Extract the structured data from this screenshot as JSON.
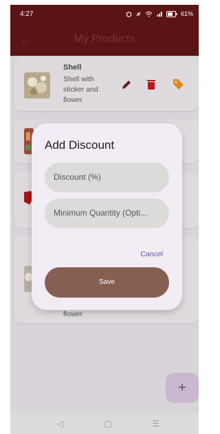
{
  "status_bar": {
    "time": "4:27",
    "battery": "61%",
    "icons": [
      "alarm-icon",
      "mute-icon",
      "wifi-icon",
      "signal-icon",
      "battery-icon"
    ]
  },
  "app_bar": {
    "title": "My Products",
    "back_icon": "back-arrow-icon"
  },
  "products": [
    {
      "name": "Shell",
      "description": "Shell with sticker and flower",
      "actions": [
        "edit-icon",
        "delete-icon",
        "discount-tag-icon"
      ]
    },
    {
      "name": "",
      "description": ""
    },
    {
      "name": "",
      "description": ""
    },
    {
      "name": "",
      "description": "flower"
    }
  ],
  "fab": {
    "label": "+"
  },
  "dialog": {
    "title": "Add Discount",
    "discount_placeholder": "Discount (%)",
    "min_qty_placeholder": "Minimum Quantity (Opti...",
    "cancel_label": "Cancel",
    "save_label": "Save"
  },
  "nav_bar": {
    "back": "◁",
    "home": "▢",
    "recents": "☰"
  },
  "colors": {
    "app_bar": "#5a1414",
    "save_button": "#875f52",
    "cancel_text": "#5f53a8",
    "edit_icon": "#6a1f1f",
    "delete_icon": "#b51d1d",
    "tag_icon": "#e08a1a"
  }
}
